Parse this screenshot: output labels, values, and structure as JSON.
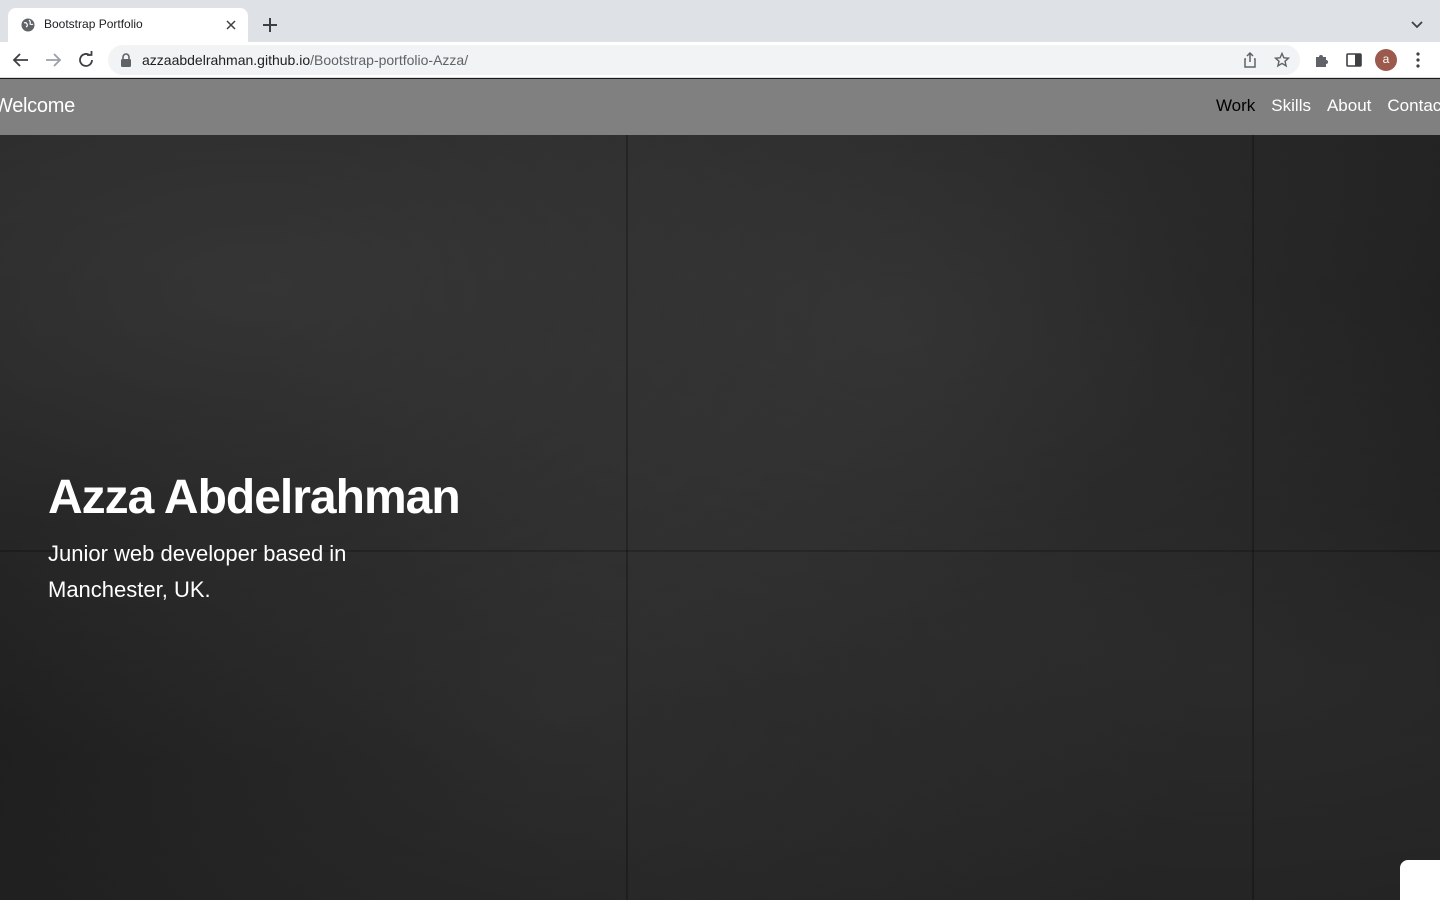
{
  "browser": {
    "tab_title": "Bootstrap Portfolio",
    "url_host": "azzaabdelrahman.github.io",
    "url_path": "/Bootstrap-portfolio-Azza/",
    "avatar_letter": "a"
  },
  "navbar": {
    "brand": "Welcome",
    "links": [
      {
        "label": "Work",
        "active": true
      },
      {
        "label": "Skills",
        "active": false
      },
      {
        "label": "About",
        "active": false
      },
      {
        "label": "Contact",
        "active": false
      }
    ]
  },
  "hero": {
    "title": "Azza Abdelrahman",
    "subtitle": "Junior web developer based in Manchester, UK."
  },
  "colors": {
    "navbar_bg": "#808080",
    "hero_bg": "#1c1c1c",
    "active_link": "#000000",
    "text": "#ffffff"
  }
}
